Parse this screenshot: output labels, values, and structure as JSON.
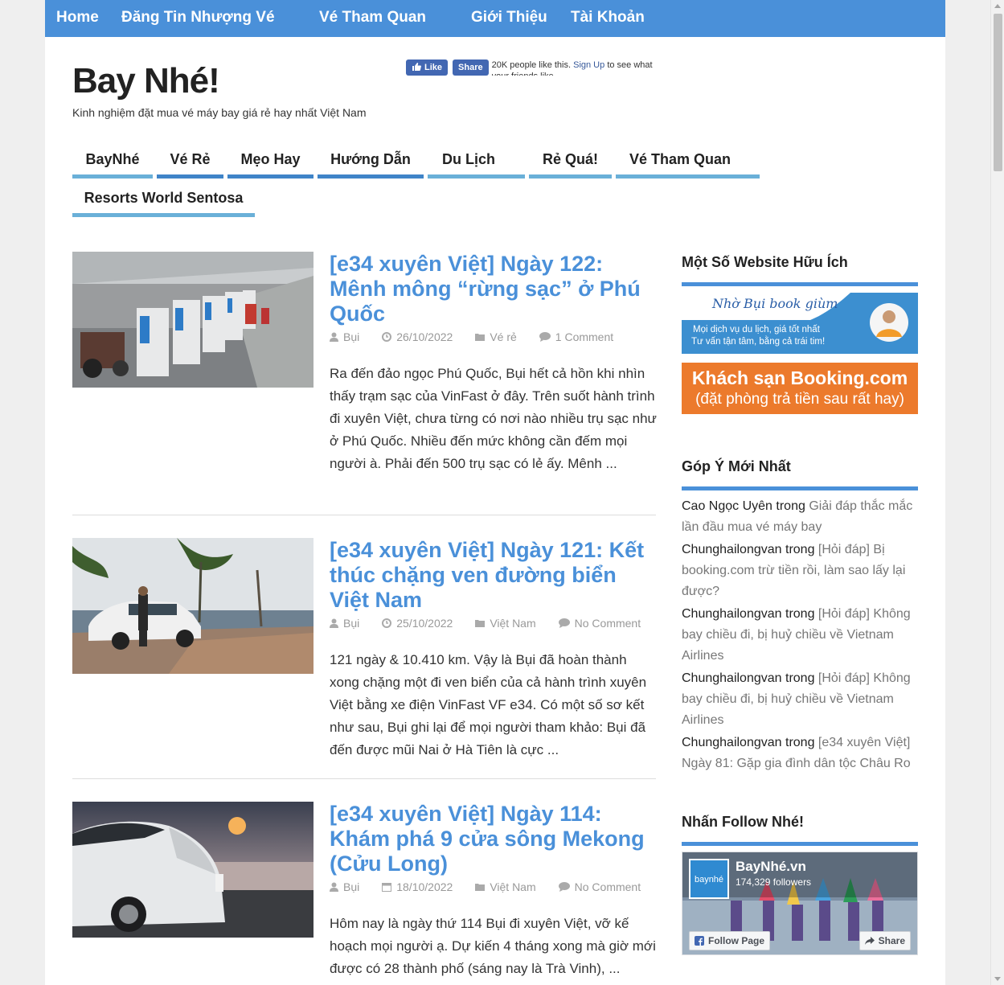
{
  "topnav": [
    "Home",
    "Đăng Tin Nhượng Vé",
    "Vé Tham Quan",
    "Giới Thiệu",
    "Tài Khoản"
  ],
  "site": {
    "title": "Bay Nhé!",
    "tagline": "Kinh nghiệm đặt mua vé máy bay giá rẻ hay nhất Việt Nam"
  },
  "fb_like": {
    "like_label": "Like",
    "share_label": "Share",
    "count_text": "20K people like this.",
    "signup_text": "Sign Up",
    "rest_text": "to see what your friends like."
  },
  "categories": [
    "BayNhé",
    "Vé Rẻ",
    "Mẹo Hay",
    "Hướng Dẫn",
    "Du Lịch",
    "Rẻ Quá!",
    "Vé Tham Quan",
    "Resorts World Sentosa"
  ],
  "posts": [
    {
      "title": "[e34 xuyên Việt] Ngày 122: Mênh mông “rừng sạc” ở Phú Quốc",
      "author": "Bụi",
      "date": "26/10/2022",
      "category": "Vé rẻ",
      "comments": "1 Comment",
      "excerpt": "Ra đến đảo ngọc Phú Quốc, Bụi hết cả hồn khi nhìn thấy trạm sạc của VinFast ở đây. Trên suốt hành trình đi xuyên Việt, chưa từng có nơi nào nhiều trụ sạc như ở Phú Quốc. Nhiều đến mức không cần đếm mọi người à. Phải đến 500 trụ sạc có lẻ ấy. Mênh ..."
    },
    {
      "title": "[e34 xuyên Việt] Ngày 121: Kết thúc chặng ven đường biển Việt Nam",
      "author": "Bụi",
      "date": "25/10/2022",
      "category": "Việt Nam",
      "comments": "No Comment",
      "excerpt": "121 ngày & 10.410 km. Vậy là Bụi đã hoàn thành xong chặng một đi ven biển của cả hành trình xuyên Việt bằng xe điện VinFast VF e34. Có một số sơ kết như sau, Bụi ghi lại để mọi người tham khảo: Bụi đã đến được mũi Nai ở Hà Tiên là cực ..."
    },
    {
      "title": "[e34 xuyên Việt] Ngày 114: Khám phá 9 cửa sông Mekong (Cửu Long)",
      "author": "Bụi",
      "date": "18/10/2022",
      "category": "Việt Nam",
      "comments": "No Comment",
      "excerpt": "Hôm nay là ngày thứ 114 Bụi đi xuyên Việt, vỡ kế hoạch mọi người ạ. Dự kiến 4 tháng xong mà giờ mới được có 28 thành phố (sáng nay là Trà Vinh), ..."
    }
  ],
  "sidebar": {
    "useful_heading": "Một Số Website Hữu Ích",
    "banner1": {
      "script_text": "Nhờ Bụi book giùm",
      "line1": "Mọi dịch vụ du lịch, giá tốt nhất",
      "line2": "Tư vấn tận tâm, bằng cả trái tim!"
    },
    "banner2": {
      "line1": "Khách sạn Booking.com",
      "line2": "(đặt phòng trả tiền sau rất hay)"
    },
    "comments_heading": "Góp Ý Mới Nhất",
    "comments": [
      {
        "author": "Cao Ngọc Uyên",
        "joiner": " trong ",
        "link": "Giải đáp thắc mắc lần đầu mua vé máy bay"
      },
      {
        "author": "Chunghailongvan",
        "joiner": " trong ",
        "link": "[Hỏi đáp] Bị booking.com trừ tiền rồi, làm sao lấy lại được?"
      },
      {
        "author": "Chunghailongvan",
        "joiner": " trong ",
        "link": "[Hỏi đáp] Không bay chiều đi, bị huỷ chiều về Vietnam Airlines"
      },
      {
        "author": "Chunghailongvan",
        "joiner": " trong ",
        "link": "[Hỏi đáp] Không bay chiều đi, bị huỷ chiều về Vietnam Airlines"
      },
      {
        "author": "Chunghailongvan",
        "joiner": " trong ",
        "link": "[e34 xuyên Việt] Ngày 81: Gặp gia đình dân tộc Châu Ro"
      }
    ],
    "follow_heading": "Nhấn Follow Nhé!",
    "fb_page": {
      "name": "BayNhé.vn",
      "followers": "174,329 followers",
      "logo_text": "baynhé",
      "follow_label": "Follow Page",
      "share_label": "Share"
    }
  }
}
